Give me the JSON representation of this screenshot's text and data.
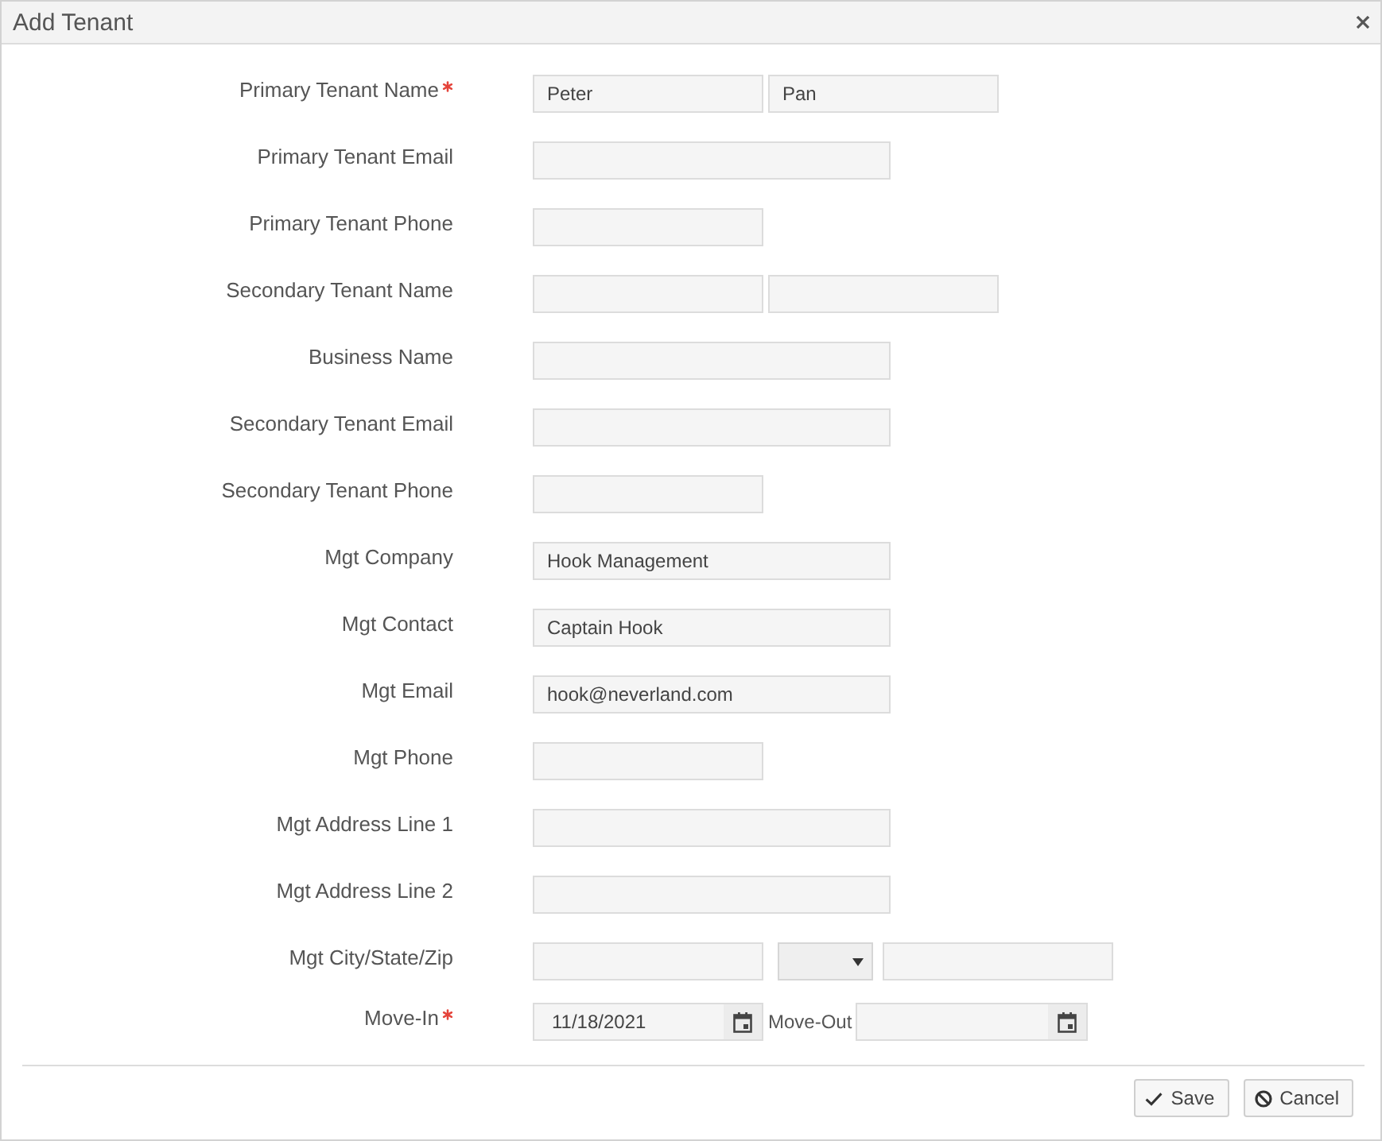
{
  "window": {
    "title": "Add Tenant"
  },
  "fields": [
    {
      "label": "Primary Tenant Name",
      "required": true,
      "kind": "name",
      "first": "Peter",
      "last": "Pan"
    },
    {
      "label": "Primary Tenant Email",
      "required": false,
      "kind": "text"
    },
    {
      "label": "Primary Tenant Phone",
      "required": false,
      "kind": "phone"
    },
    {
      "label": "Secondary Tenant Name",
      "required": false,
      "kind": "name"
    },
    {
      "label": "Business Name",
      "required": false,
      "kind": "text"
    },
    {
      "label": "Secondary Tenant Email",
      "required": false,
      "kind": "text"
    },
    {
      "label": "Secondary Tenant Phone",
      "required": false,
      "kind": "phone"
    },
    {
      "label": "Mgt Company",
      "required": false,
      "kind": "text",
      "value": "Hook Management"
    },
    {
      "label": "Mgt Contact",
      "required": false,
      "kind": "text",
      "value": "Captain Hook"
    },
    {
      "label": "Mgt Email",
      "required": false,
      "kind": "text",
      "value": "hook@neverland.com"
    },
    {
      "label": "Mgt Phone",
      "required": false,
      "kind": "phone"
    },
    {
      "label": "Mgt Address Line 1",
      "required": false,
      "kind": "text"
    },
    {
      "label": "Mgt Address Line 2",
      "required": false,
      "kind": "text"
    },
    {
      "label": "Mgt City/State/Zip",
      "required": false,
      "kind": "city_state_zip"
    },
    {
      "label": "Move-In",
      "required": true,
      "kind": "dates",
      "value": "11/18/2021",
      "end_label": "Move-Out"
    }
  ],
  "buttons": [
    {
      "label": "Save",
      "kind": "save"
    },
    {
      "label": "Cancel",
      "kind": "cancel"
    }
  ]
}
